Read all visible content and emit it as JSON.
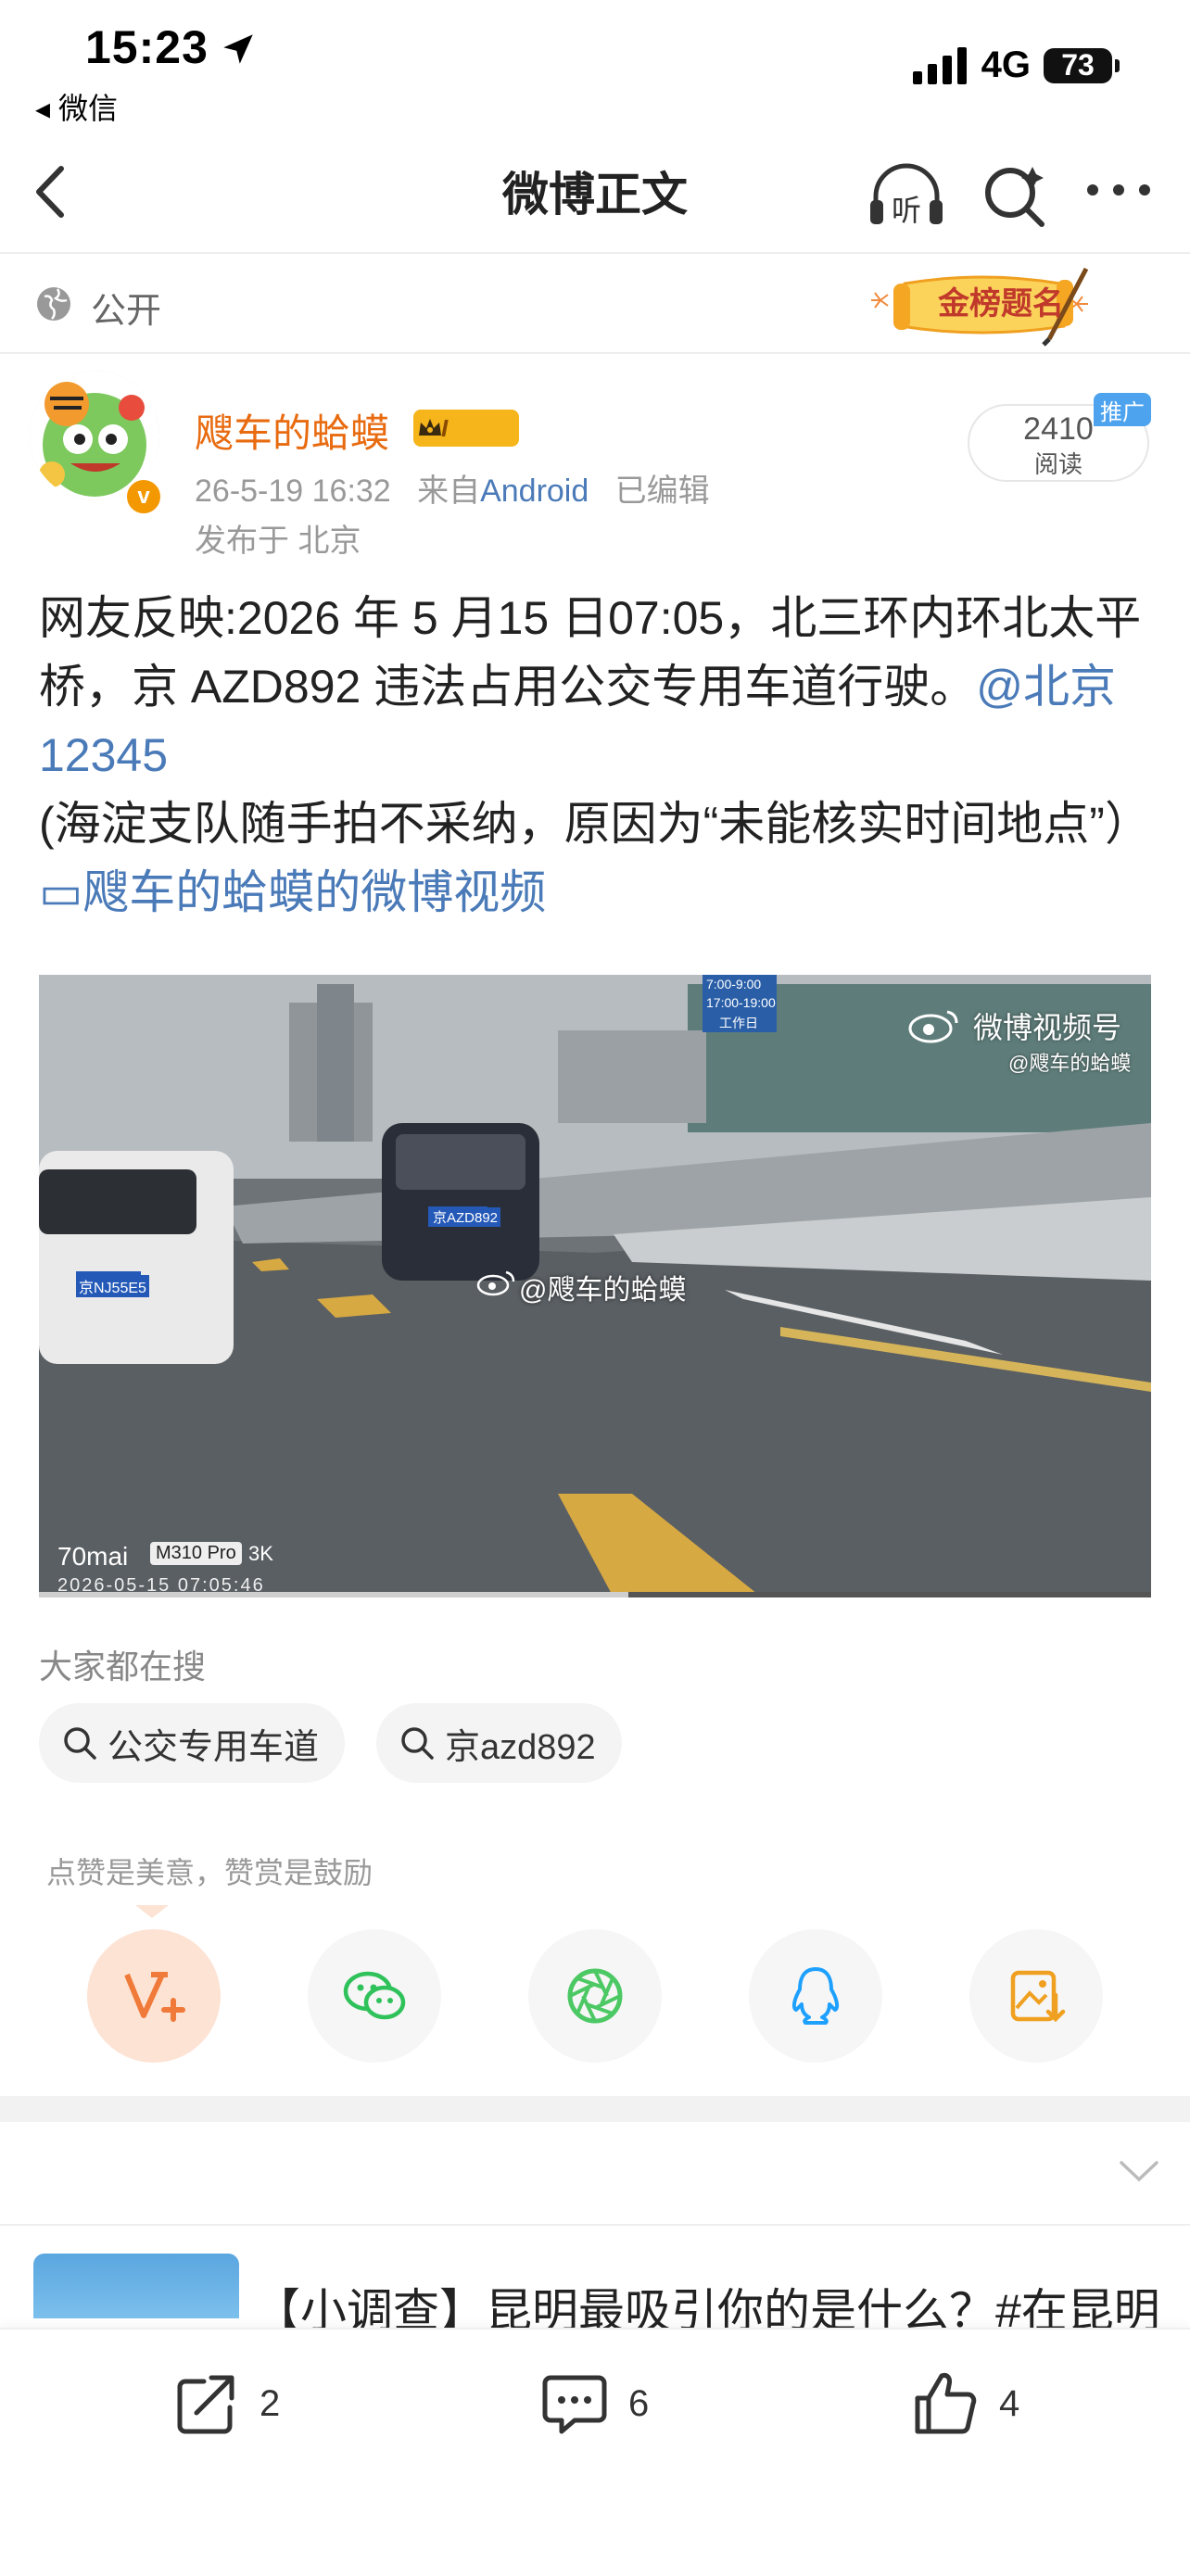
{
  "status_bar": {
    "time": "15:23",
    "back_app": "◂ 微信",
    "network": "4G",
    "battery": "73"
  },
  "nav": {
    "title": "微博正文",
    "listen_label": "听"
  },
  "visibility": {
    "label": "公开",
    "badge": "金榜题名"
  },
  "author": {
    "name": "飕车的蛤蟆",
    "level": "I",
    "verify_mark": "v",
    "timestamp": "26-5-19 16:32",
    "source_prefix": "来自",
    "source": "Android",
    "edited": "已编辑",
    "location": "发布于 北京"
  },
  "reads": {
    "count": "2410",
    "label": "阅读",
    "promo": "推广"
  },
  "post": {
    "text1": "网友反映:2026 年 5 月15 日07:05，北三环内环北太平桥，京 AZD892 违法占用公交专用车道行驶。",
    "mention": "@北京12345",
    "text2": "(海淀支队随手拍不采纳，原因为“未能核实时间地点”）",
    "video_link": "▭飕车的蛤蟆的微博视频"
  },
  "video": {
    "watermark": "微博视频号",
    "watermark_sub": "@飕车的蛤蟆",
    "center_watermark": "@飕车的蛤蟆",
    "camera_brand": "70mai",
    "camera_model": "M310 Pro",
    "resolution": "3K",
    "timestamp": "2026-05-15 07:05:46",
    "left_plate": "京NJ55E5",
    "center_plate": "京AZD892",
    "sign_time1": "7:00-9:00",
    "sign_time2": "17:00-19:00",
    "sign_day": "工作日",
    "progress_fraction": 0.53
  },
  "search": {
    "heading": "大家都在搜",
    "chips": [
      {
        "label": "公交专用车道"
      },
      {
        "label": "京azd892"
      }
    ]
  },
  "reward": {
    "heading": "点赞是美意，赞赏是鼓励"
  },
  "next_post": {
    "title": "【小调查】昆明最吸引你的是什么？#在昆明"
  },
  "actions": {
    "repost_count": "2",
    "comment_count": "6",
    "like_count": "4"
  },
  "colors": {
    "accent_orange": "#e86b10",
    "link_blue": "#4a7ab8",
    "wechat_green": "#2fc25b",
    "moments_green": "#4cc864",
    "qq_blue": "#1ea0ff",
    "save_orange": "#f0a020"
  }
}
